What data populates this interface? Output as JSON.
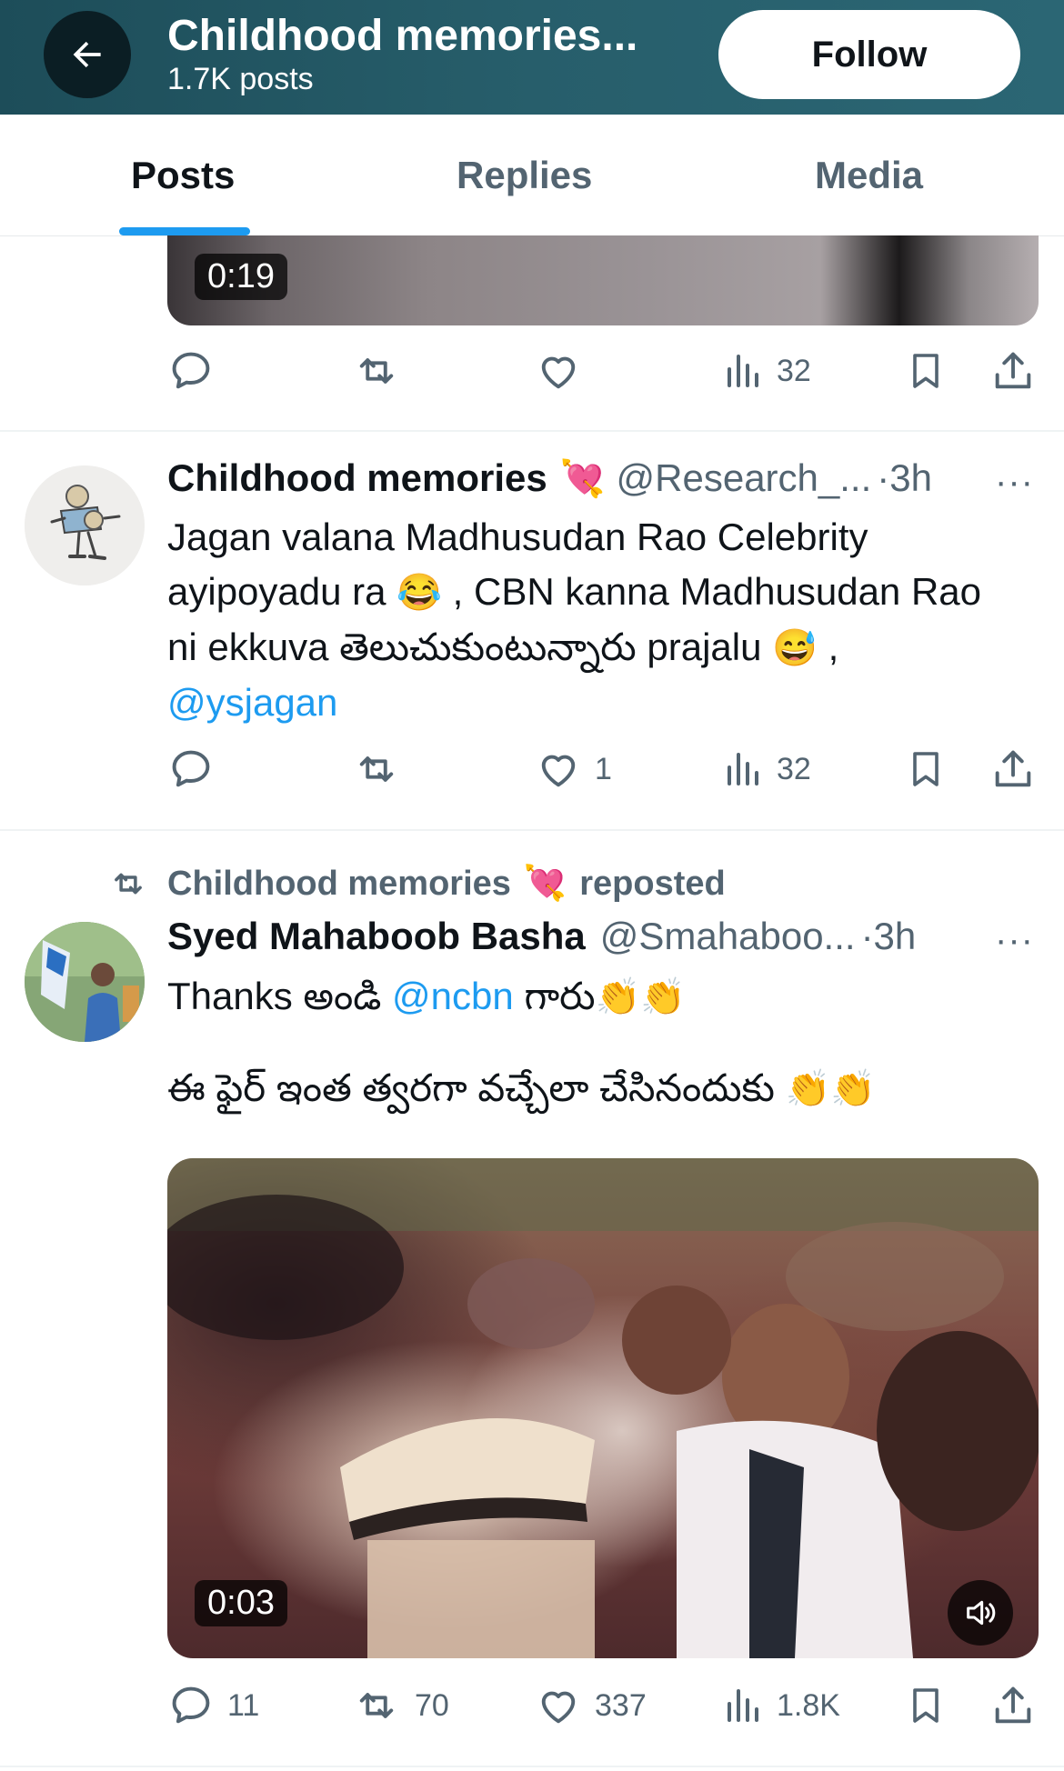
{
  "header": {
    "title": "Childhood memories...",
    "posts_count": "1.7K posts",
    "follow_label": "Follow"
  },
  "tabs": [
    {
      "label": "Posts",
      "active": true
    },
    {
      "label": "Replies",
      "active": false
    },
    {
      "label": "Media",
      "active": false
    }
  ],
  "prev_post": {
    "video_duration": "0:19",
    "actions": {
      "reply": "",
      "repost": "",
      "like": "",
      "views": "32"
    }
  },
  "tweet1": {
    "name": "Childhood memories",
    "name_emoji": "💘",
    "handle": "@Research_...",
    "time": "·3h",
    "more": "···",
    "line1": "Jagan valana Madhusudan Rao Celebrity",
    "line2a": "ayipoyadu ra",
    "emoji_a": "😂",
    "line2b": ", CBN kanna Madhusudan Rao",
    "line3a": "ni ekkuva తెలుచుకుంటున్నారు prajalu",
    "emoji_b": "😅",
    "line3b": ",",
    "mention": "@ysjagan",
    "actions": {
      "reply": "",
      "repost": "",
      "like": "1",
      "views": "32"
    }
  },
  "repost_info": {
    "reposter": "Childhood memories",
    "emoji": "💘",
    "label": "reposted"
  },
  "tweet2": {
    "name": "Syed Mahaboob Basha",
    "handle": "@Smahaboo...",
    "time": "·3h",
    "more": "···",
    "line1a": "Thanks అండి",
    "mention": "@ncbn",
    "line1b": "గారు",
    "clap1": "👏👏",
    "line2": "ఈ ఫైర్ ఇంత త్వరగా వచ్చేలా చేసినందుకు",
    "clap2": "👏👏",
    "video_duration": "0:03",
    "actions": {
      "reply": "11",
      "repost": "70",
      "like": "337",
      "views": "1.8K"
    }
  },
  "icons": {
    "back": "arrow-left-icon",
    "reply": "speech-bubble-icon",
    "repost": "repost-arrows-icon",
    "like": "heart-icon",
    "views": "bar-chart-icon",
    "bookmark": "bookmark-icon",
    "share": "share-upload-icon",
    "sound": "speaker-icon"
  },
  "colors": {
    "header_bg": "#275e6b",
    "accent": "#1d9bf0",
    "muted": "#536471"
  }
}
